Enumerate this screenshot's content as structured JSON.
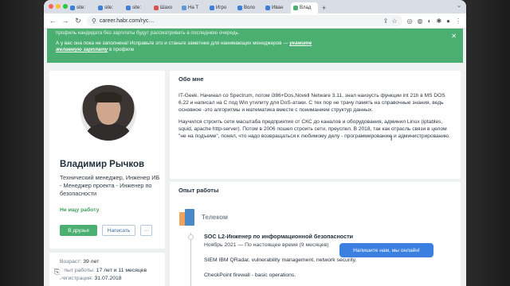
{
  "tabs": [
    {
      "label": "site:",
      "active": false,
      "color": "#3d7fd6"
    },
    {
      "label": "site:",
      "active": false,
      "color": "#3d7fd6"
    },
    {
      "label": "site:",
      "active": false,
      "color": "#3d7fd6"
    },
    {
      "label": "Шахо",
      "active": false,
      "color": "#d9534f"
    },
    {
      "label": "На Т",
      "active": false,
      "color": "#5b9bd5"
    },
    {
      "label": "Игро",
      "active": false,
      "color": "#3d7fd6"
    },
    {
      "label": "Воло",
      "active": false,
      "color": "#3d7fd6"
    },
    {
      "label": "Иван",
      "active": false,
      "color": "#3d7fd6"
    },
    {
      "label": "Влад",
      "active": true,
      "color": "#4caf72"
    }
  ],
  "toolbar": {
    "url": "career.habr.com/ryc…",
    "back_icon": "back-arrow-icon",
    "forward_icon": "forward-arrow-icon",
    "reload_icon": "reload-icon"
  },
  "banner": {
    "line1": "профиль кандидата без зарплаты будут рассматривать в последнюю очередь.",
    "line2_prefix": "А у вас она пока не заполнена! Исправьте это и станьте заметнее для нанимающих менеджеров —",
    "line2_link": "укажите",
    "line3_link": "желаемую зарплату",
    "line3_suffix": "в профиле",
    "accent": "#4caf72"
  },
  "profile": {
    "name": "Владимир Рычков",
    "description": "Технический менеджер, Инженер ИБ - Менеджер проекта - Инженер по безопасности",
    "status": "Не ищу работу",
    "btn_friends": "В друзья",
    "btn_write": "Написать",
    "btn_more": "···",
    "age_label": "Возраст:",
    "age_value": "39 лет",
    "exp_label": "Опыт работы:",
    "exp_value": "17 лет и 11 месяцев",
    "reg_label": "Регистрация:",
    "reg_value": "31.07.2018"
  },
  "about": {
    "title": "Обо мне",
    "p1": "IT-Geek. Начинал со Spectrum, потом i386+Dos,Novell Netware 3.11, знал наизусть функции int 21h в MS DOS 6.22 и написал на С под Win утилиту для DoS-атаки. С тех пор не трачу память на справочные знания, ведь основное -это алгоритмы и математика вместе с пониманием структур данных.",
    "p2": "Научился строить сети масштаба предприятия от СКС до каналов и оборудования, админил Linux (iptables, squid, apache http-server). Потом в 2006 пошел строить сети, преуспел. В 2018, так как отрасль связи в целом \"не на подъеме\", понял, что надо возвращаться к любимому делу - программированию и администрированию."
  },
  "experience": {
    "title": "Опыт работы",
    "company": "Телеком",
    "job_title": "SOC L2-Инженер по информационной безопасности",
    "job_dates": "Ноябрь 2021 — По настоящее время (9 месяцев)",
    "line1": "SIEM IBM QRadar, vulnerability management, network security.",
    "line2": "CheckPoint firewall - basic operations."
  },
  "chat": {
    "label": "Напишите нам, мы онлайн!",
    "color": "#3b7fe0"
  }
}
